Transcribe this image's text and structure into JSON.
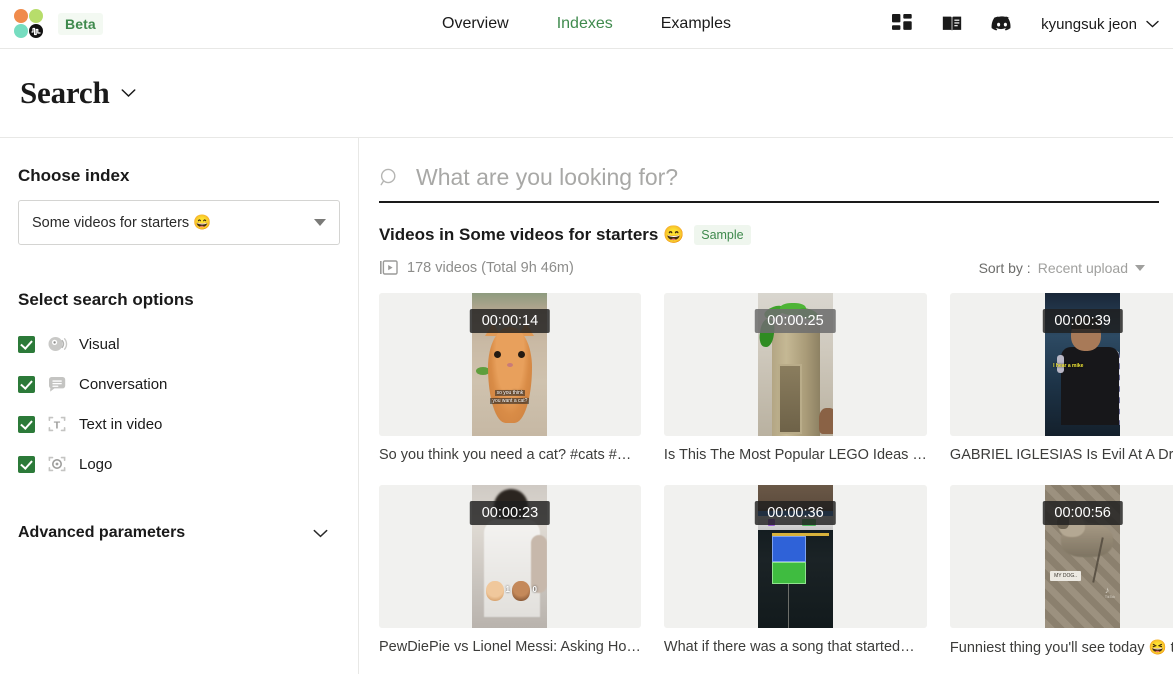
{
  "header": {
    "beta_label": "Beta",
    "nav": [
      {
        "label": "Overview",
        "active": false
      },
      {
        "label": "Indexes",
        "active": true
      },
      {
        "label": "Examples",
        "active": false
      }
    ],
    "icons": [
      "dashboard-icon",
      "docs-icon",
      "discord-icon"
    ],
    "user_name": "kyungsuk jeon",
    "accent_green": "#3f8a4d"
  },
  "page": {
    "title": "Search"
  },
  "sidebar": {
    "choose_index_label": "Choose index",
    "selected_index": "Some videos for starters 😄",
    "search_options_label": "Select search options",
    "options": [
      {
        "label": "Visual",
        "icon": "visual-icon",
        "checked": true
      },
      {
        "label": "Conversation",
        "icon": "conversation-icon",
        "checked": true
      },
      {
        "label": "Text in video",
        "icon": "text-in-video-icon",
        "checked": true
      },
      {
        "label": "Logo",
        "icon": "logo-detect-icon",
        "checked": true
      }
    ],
    "advanced_label": "Advanced parameters"
  },
  "search": {
    "placeholder": "What are you looking for?",
    "value": ""
  },
  "results": {
    "title": "Videos in Some videos for starters 😄",
    "badge": "Sample",
    "count_text": "178 videos (Total 9h 46m)",
    "sort_label": "Sort by :",
    "sort_value": "Recent upload",
    "videos": [
      {
        "duration": "00:00:14",
        "title": "So you think you need a cat? #cats #…",
        "art": "cat",
        "badge_style": "dark",
        "caption_line1": "so you think",
        "caption_line2": "you want a cat?"
      },
      {
        "duration": "00:00:25",
        "title": "Is This The Most Popular LEGO Ideas …",
        "art": "lego",
        "badge_style": "gray"
      },
      {
        "duration": "00:00:39",
        "title": "GABRIEL IGLESIAS Is Evil At A Drive-t…",
        "art": "stage",
        "badge_style": "dark",
        "subtitle": "I hear a mike"
      },
      {
        "duration": "00:00:23",
        "title": "PewDiePie vs Lionel Messi: Asking Ho…",
        "art": "pew",
        "badge_style": "dark",
        "score_a": "1",
        "score_b": "0"
      },
      {
        "duration": "00:00:36",
        "title": "What if there was a song that started…",
        "art": "daw",
        "badge_style": "dark"
      },
      {
        "duration": "00:00:56",
        "title": "Funniest thing you'll see today 😆 the…",
        "art": "dog",
        "badge_style": "dark",
        "tag": "MY DOG.."
      }
    ]
  }
}
